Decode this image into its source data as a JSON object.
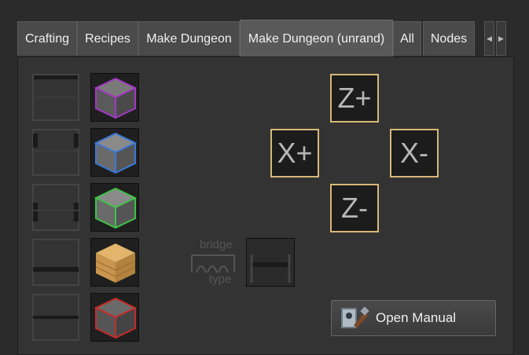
{
  "tabs": [
    {
      "label": "Crafting"
    },
    {
      "label": "Recipes"
    },
    {
      "label": "Make Dungeon"
    },
    {
      "label": "Make Dungeon (unrand)"
    },
    {
      "label": "All"
    },
    {
      "label": "Nodes"
    }
  ],
  "active_tab": "Make Dungeon (unrand)",
  "scroll_icons": [
    "chevron-left-icon",
    "chevron-right-icon"
  ],
  "blocks": [
    {
      "icon": "purple-stone-block-icon",
      "color": "#a338c2"
    },
    {
      "icon": "blue-stone-block-icon",
      "color": "#3a78d6"
    },
    {
      "icon": "green-stone-block-icon",
      "color": "#3fc247"
    },
    {
      "icon": "wood-plank-block-icon",
      "color": "#d9a45a"
    },
    {
      "icon": "red-stone-block-icon",
      "color": "#c62b2b"
    }
  ],
  "directions": {
    "zplus": "Z+",
    "xplus": "X+",
    "xminus": "X-",
    "zminus": "Z-"
  },
  "bridge": {
    "top": "bridge",
    "bottom": "type"
  },
  "manual_button": {
    "label": "Open Manual",
    "icon": "manual-book-icon"
  },
  "accent_color": "#d8b878"
}
